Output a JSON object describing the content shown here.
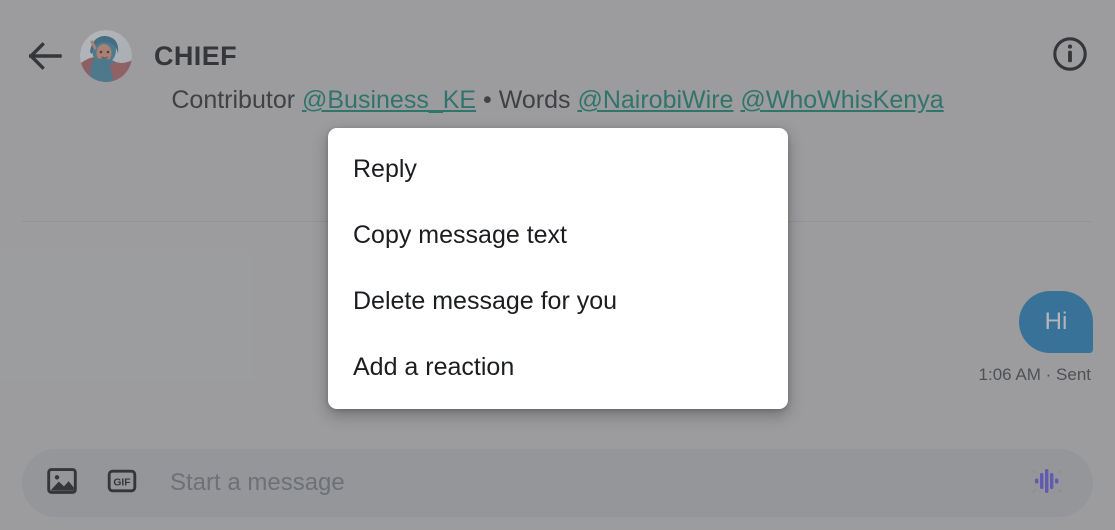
{
  "header": {
    "back_icon": "arrow-left-icon",
    "avatar_alt": "contact-avatar",
    "title": "CHIEF",
    "info_icon": "info-circle-icon"
  },
  "conversation": {
    "clipped_message": {
      "prefix": "Contributor ",
      "mention_1": "@Business_KE",
      "separator": " • ",
      "middle": "Words ",
      "mention_2": "@NairobiWire",
      "space": " ",
      "mention_3": "@WhoWhisKenya",
      "link_color": "#11776a"
    },
    "outgoing_message": {
      "text": "Hi",
      "bubble_color": "#1d74ae",
      "text_color": "#d7dade",
      "meta": "1:06 AM · Sent"
    }
  },
  "composer": {
    "image_icon": "image-icon",
    "gif_icon": "gif-icon",
    "gif_label": "GIF",
    "placeholder": "Start a message",
    "voice_icon": "audio-waveform-icon",
    "voice_icon_color": "#5a4fcf"
  },
  "context_menu": {
    "items": [
      {
        "label": "Reply",
        "name": "menu-item-reply"
      },
      {
        "label": "Copy message text",
        "name": "menu-item-copy-message-text"
      },
      {
        "label": "Delete message for you",
        "name": "menu-item-delete-message-for-you"
      },
      {
        "label": "Add a reaction",
        "name": "menu-item-add-a-reaction"
      }
    ]
  },
  "colors": {
    "background": "#b3b4b5",
    "composer_bg": "#a9abad",
    "scrim": "rgba(110,112,115,0.34)",
    "menu_bg": "#ffffff",
    "divider": "#a0a8ae"
  }
}
